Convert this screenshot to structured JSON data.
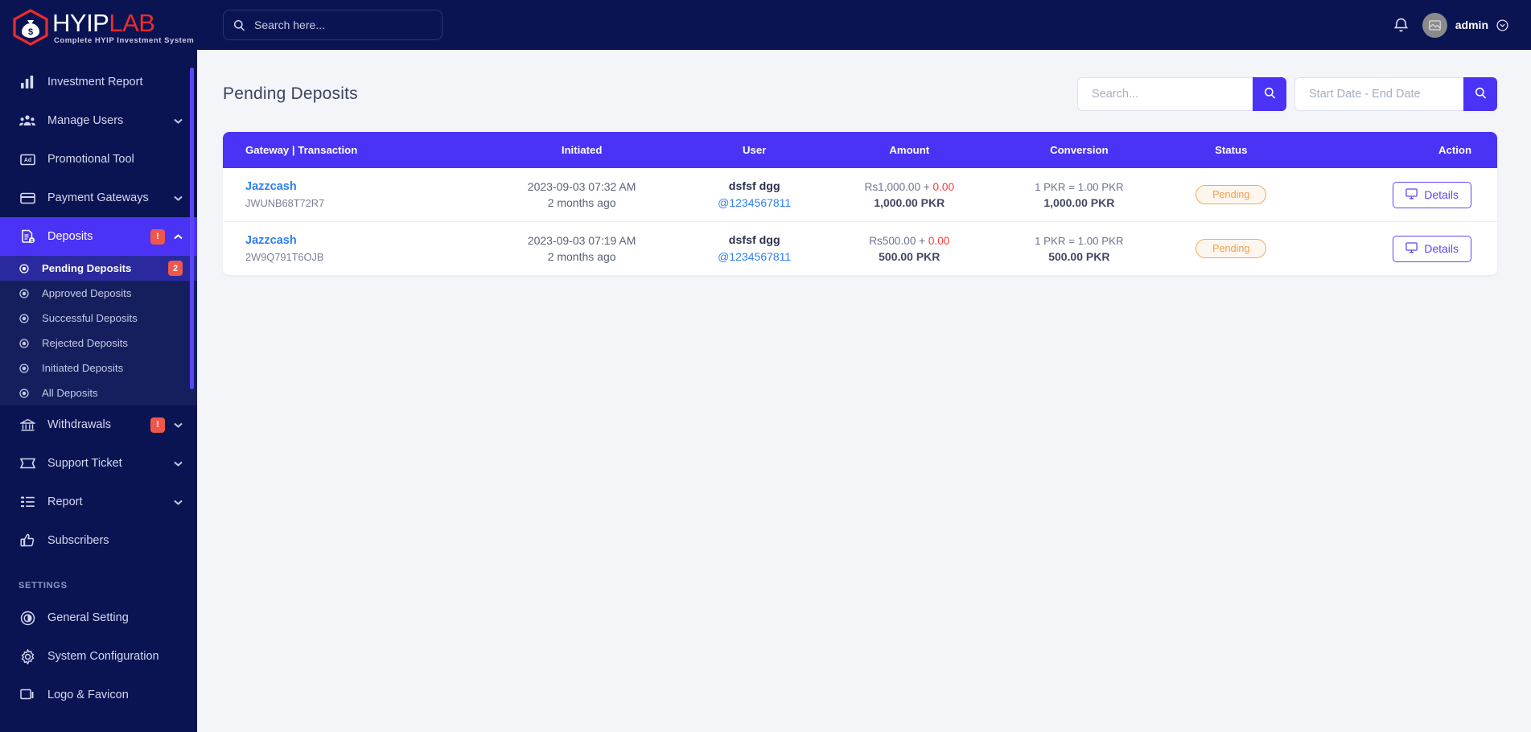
{
  "brand": {
    "name_primary": "HYIP",
    "name_secondary": "LAB",
    "tagline": "Complete HYIP Investment System",
    "logo_icon": "money-bag-hexagon-icon",
    "color_primary": "#ffffff",
    "color_secondary": "#ee2b2b"
  },
  "topbar": {
    "search_placeholder": "Search here...",
    "search_value": "",
    "search_icon": "search-icon",
    "notification_icon": "bell-icon",
    "avatar_icon": "broken-image-icon",
    "username": "admin",
    "caret_icon": "chevron-down-circle-icon"
  },
  "sidebar": {
    "items": [
      {
        "label": "Investment Report",
        "icon": "bar-chart-icon",
        "active": false,
        "badge": "",
        "chevron": ""
      },
      {
        "label": "Manage Users",
        "icon": "users-group-icon",
        "active": false,
        "badge": "",
        "chevron": "down"
      },
      {
        "label": "Promotional Tool",
        "icon": "ad-banner-icon",
        "active": false,
        "badge": "",
        "chevron": ""
      },
      {
        "label": "Payment Gateways",
        "icon": "credit-card-icon",
        "active": false,
        "badge": "",
        "chevron": "down"
      },
      {
        "label": "Deposits",
        "icon": "invoice-dollar-icon",
        "active": true,
        "badge": "!",
        "chevron": "up"
      }
    ],
    "deposits_submenu": [
      {
        "label": "Pending Deposits",
        "icon": "circle-dot-icon",
        "active": true,
        "badge": "2"
      },
      {
        "label": "Approved Deposits",
        "icon": "circle-dot-icon",
        "active": false,
        "badge": ""
      },
      {
        "label": "Successful Deposits",
        "icon": "circle-dot-icon",
        "active": false,
        "badge": ""
      },
      {
        "label": "Rejected Deposits",
        "icon": "circle-dot-icon",
        "active": false,
        "badge": ""
      },
      {
        "label": "Initiated Deposits",
        "icon": "circle-dot-icon",
        "active": false,
        "badge": ""
      },
      {
        "label": "All Deposits",
        "icon": "circle-dot-icon",
        "active": false,
        "badge": ""
      }
    ],
    "items_after": [
      {
        "label": "Withdrawals",
        "icon": "bank-icon",
        "active": false,
        "badge": "!",
        "chevron": "down"
      },
      {
        "label": "Support Ticket",
        "icon": "ticket-icon",
        "active": false,
        "badge": "",
        "chevron": "down"
      },
      {
        "label": "Report",
        "icon": "list-icon",
        "active": false,
        "badge": "",
        "chevron": "down"
      },
      {
        "label": "Subscribers",
        "icon": "thumbs-up-icon",
        "active": false,
        "badge": "",
        "chevron": ""
      }
    ],
    "settings_header": "SETTINGS",
    "settings_items": [
      {
        "label": "General Setting",
        "icon": "disc-settings-icon",
        "active": false,
        "badge": "",
        "chevron": ""
      },
      {
        "label": "System Configuration",
        "icon": "gear-icon",
        "active": false,
        "badge": "",
        "chevron": ""
      },
      {
        "label": "Logo & Favicon",
        "icon": "image-icon",
        "active": false,
        "badge": "",
        "chevron": ""
      }
    ]
  },
  "page": {
    "title": "Pending Deposits",
    "search_placeholder": "Search...",
    "search_value": "",
    "date_placeholder": "Start Date - End Date",
    "date_value": "",
    "search_button_icon": "search-icon",
    "accent_color": "#4a33f5"
  },
  "table": {
    "columns": [
      "Gateway | Transaction",
      "Initiated",
      "User",
      "Amount",
      "Conversion",
      "Status",
      "Action"
    ],
    "rows": [
      {
        "gateway": "Jazzcash",
        "transaction": "JWUNB68T72R7",
        "initiated_date": "2023-09-03 07:32 AM",
        "initiated_relative": "2 months ago",
        "user_name": "dsfsf dgg",
        "user_handle": "@1234567811",
        "amount_base": "Rs1,000.00 + ",
        "amount_charge": "0.00",
        "amount_total": "1,000.00 PKR",
        "conversion_rate": "1 PKR = 1.00 PKR",
        "conversion_total": "1,000.00 PKR",
        "status": "Pending",
        "action_label": "Details",
        "action_icon": "monitor-icon"
      },
      {
        "gateway": "Jazzcash",
        "transaction": "2W9Q791T6OJB",
        "initiated_date": "2023-09-03 07:19 AM",
        "initiated_relative": "2 months ago",
        "user_name": "dsfsf dgg",
        "user_handle": "@1234567811",
        "amount_base": "Rs500.00 + ",
        "amount_charge": "0.00",
        "amount_total": "500.00 PKR",
        "conversion_rate": "1 PKR = 1.00 PKR",
        "conversion_total": "500.00 PKR",
        "status": "Pending",
        "action_label": "Details",
        "action_icon": "monitor-icon"
      }
    ]
  }
}
